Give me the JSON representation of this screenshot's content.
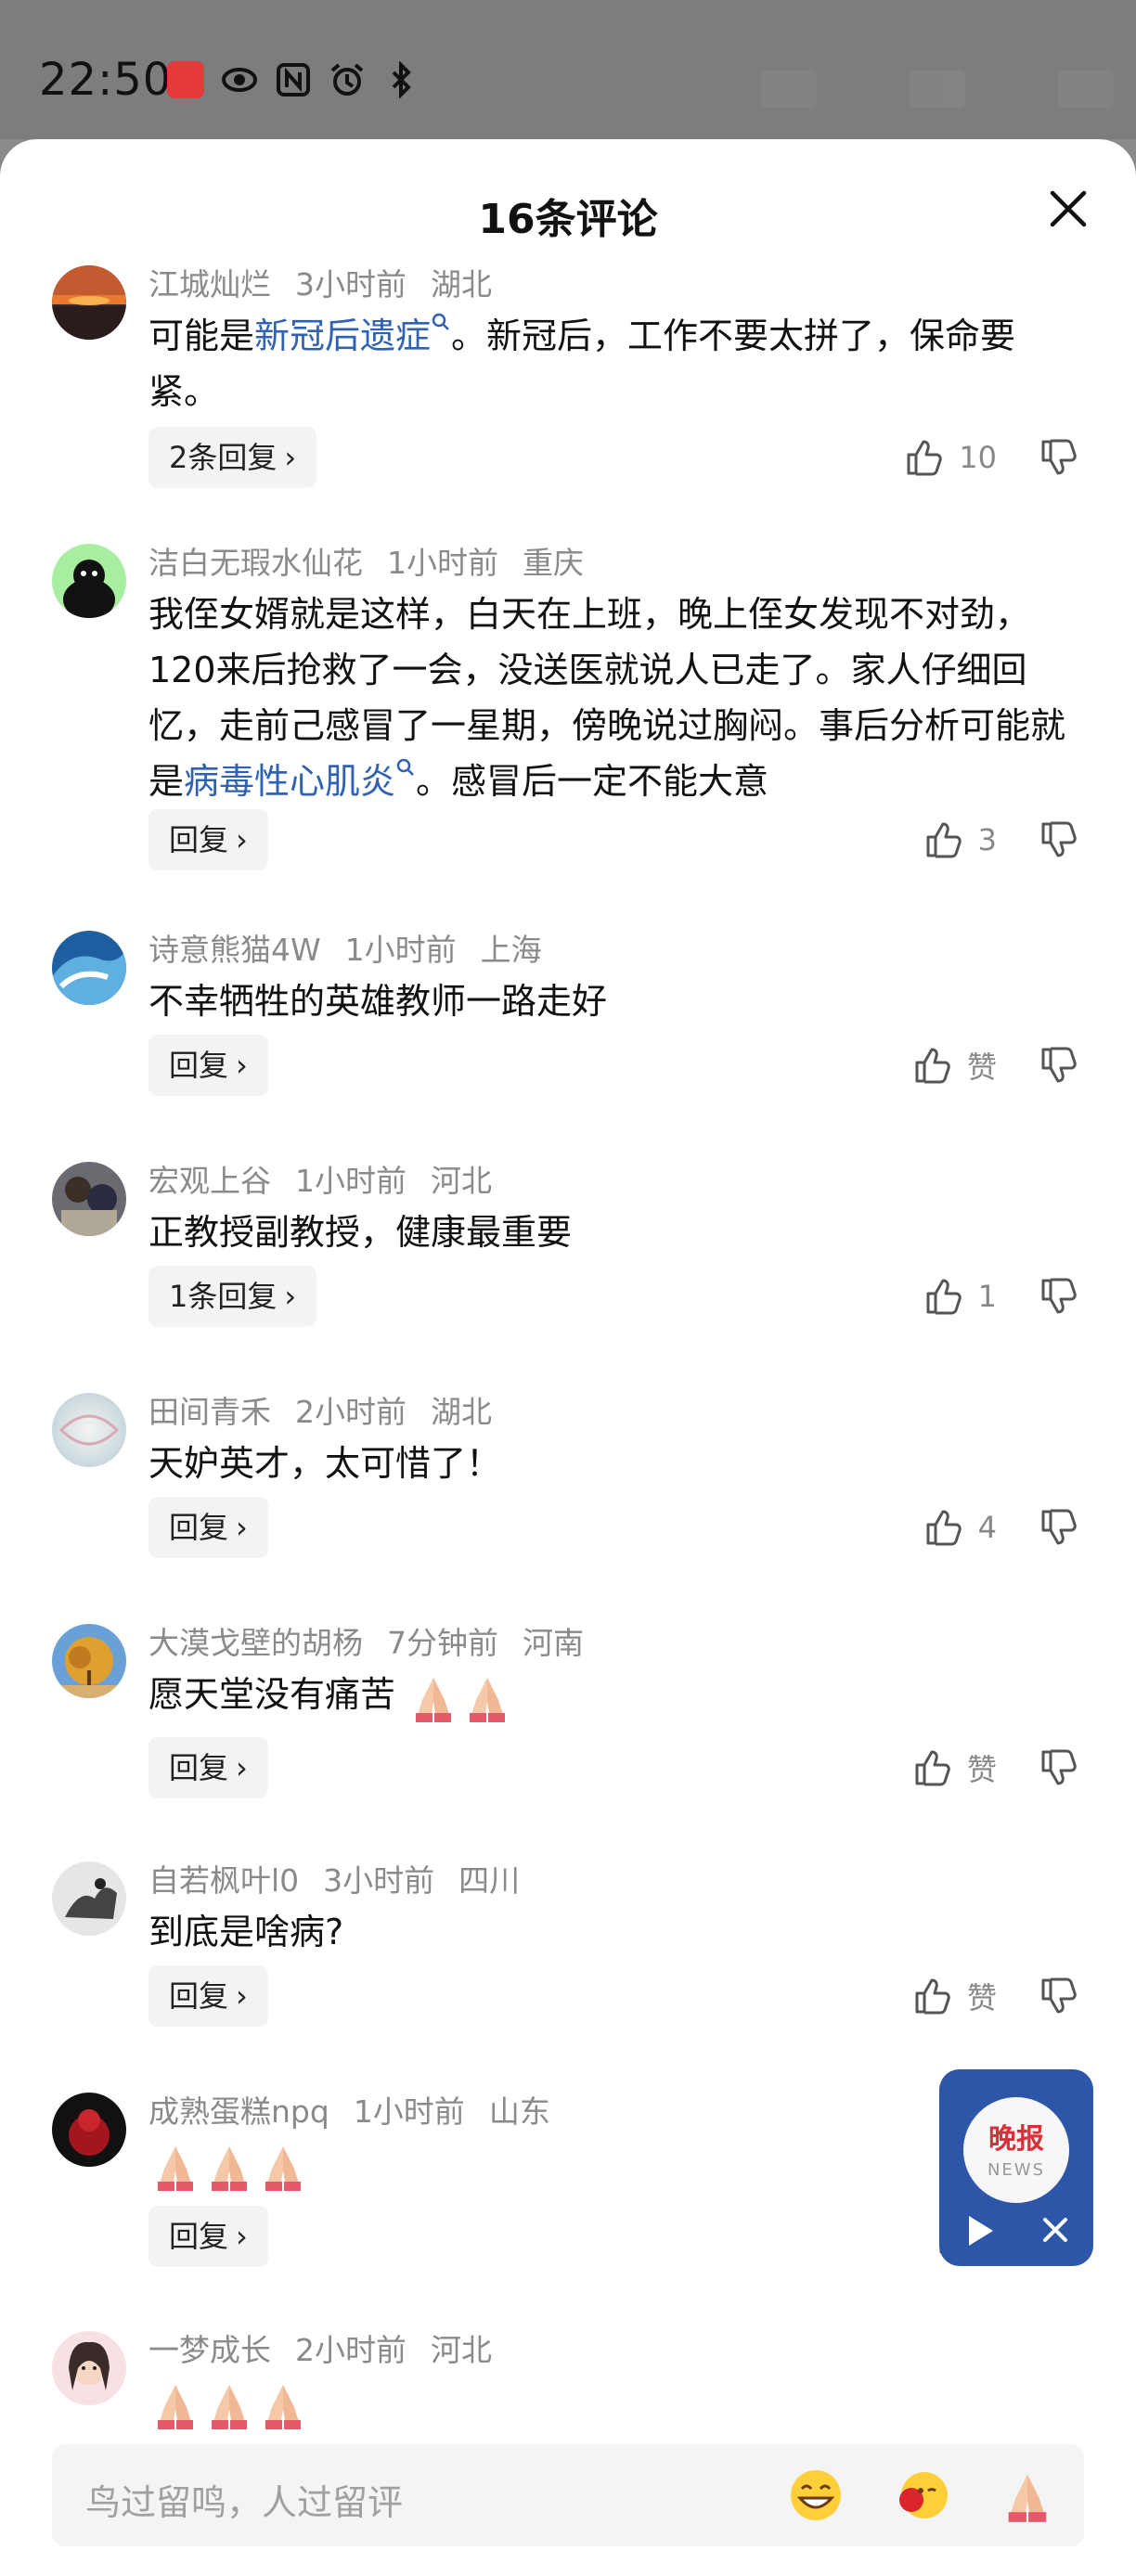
{
  "status_bar": {
    "time": "22:50"
  },
  "sheet": {
    "title": "16条评论"
  },
  "comments": [
    {
      "user": "江城灿烂",
      "time": "3小时前",
      "location": "湖北",
      "text_parts": [
        "可能是",
        "新冠后遗症",
        "。新冠后，工作不要太拼了，保命要紧。"
      ],
      "reply_label": "2条回复",
      "likes": "10"
    },
    {
      "user": "洁白无瑕水仙花",
      "time": "1小时前",
      "location": "重庆",
      "text_parts": [
        "我侄女婿就是这样，白天在上班，晚上侄女发现不对劲，120来后抢救了一会，没送医就说人已走了。家人仔细回忆，走前己感冒了一星期，傍晚说过胸闷。事后分析可能就是",
        "病毒性心肌炎",
        "。感冒后一定不能大意"
      ],
      "reply_label": "回复",
      "likes": "3"
    },
    {
      "user": "诗意熊猫4W",
      "time": "1小时前",
      "location": "上海",
      "text": "不幸牺牲的英雄教师一路走好",
      "reply_label": "回复",
      "likes": "赞"
    },
    {
      "user": "宏观上谷",
      "time": "1小时前",
      "location": "河北",
      "text": "正教授副教授，健康最重要",
      "reply_label": "1条回复",
      "likes": "1"
    },
    {
      "user": "田间青禾",
      "time": "2小时前",
      "location": "湖北",
      "text": "天妒英才，太可惜了！",
      "reply_label": "回复",
      "likes": "4"
    },
    {
      "user": "大漠戈壁的胡杨",
      "time": "7分钟前",
      "location": "河南",
      "text": "愿天堂没有痛苦",
      "reply_label": "回复",
      "likes": "赞"
    },
    {
      "user": "自若枫叶l0",
      "time": "3小时前",
      "location": "四川",
      "text": "到底是啥病?",
      "reply_label": "回复",
      "likes": "赞"
    },
    {
      "user": "成熟蛋糕npq",
      "time": "1小时前",
      "location": "山东",
      "text": "",
      "reply_label": "回复",
      "likes": ""
    },
    {
      "user": "一梦成长",
      "time": "2小时前",
      "location": "河北",
      "text": "",
      "reply_label": "",
      "likes": ""
    }
  ],
  "widget": {
    "logo_cn": "晚报",
    "logo_en": "NEWS"
  },
  "input": {
    "placeholder": "鸟过留鸣，人过留评"
  },
  "icons": [
    "eye-icon",
    "nfc-icon",
    "alarm-icon",
    "bluetooth-icon",
    "close-icon",
    "thumbs-up-icon",
    "thumbs-down-icon",
    "search-tag-icon",
    "play-icon",
    "folded-hands-emoji",
    "grin-emoji",
    "flower-kiss-emoji"
  ],
  "colors": {
    "link": "#2f62b5",
    "widget_bg": "#2d56a8",
    "logo_red": "#d9303a"
  }
}
